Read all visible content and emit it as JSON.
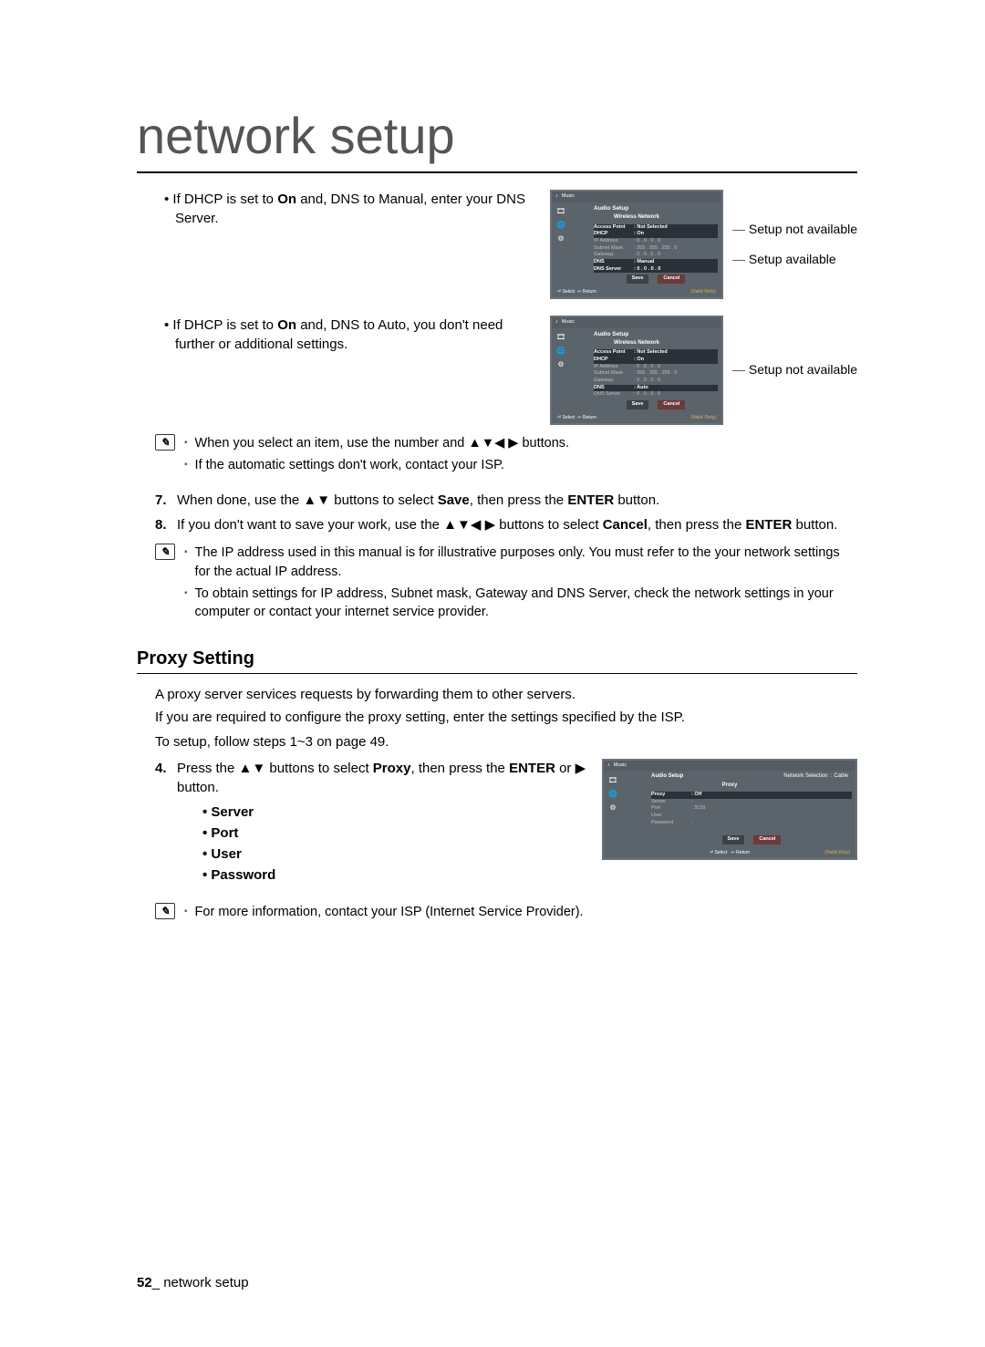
{
  "title": "network setup",
  "block1": {
    "bullet": "If DHCP is set to On and, DNS to Manual, enter your DNS Server.",
    "bold_word": "On",
    "caption1": "Setup not available",
    "caption2": "Setup available"
  },
  "block2": {
    "bullet": "If DHCP is set to On and, DNS to Auto, you don't need further or additional settings.",
    "bold_word": "On",
    "caption1": "Setup not available"
  },
  "note1": {
    "line1": "When you select an item, use the number and ▲▼◀ ▶ buttons.",
    "line2": "If the automatic settings don't work, contact your ISP."
  },
  "steps": {
    "s7": {
      "num": "7.",
      "text_a": "When done, use the ▲▼ buttons to select ",
      "bold1": "Save",
      "text_b": ", then press the ",
      "bold2": "ENTER",
      "text_c": " button."
    },
    "s8": {
      "num": "8.",
      "text_a": "If you don't want to save your work, use the ▲▼◀ ▶ buttons to select ",
      "bold1": "Cancel",
      "text_b": ", then press the ",
      "bold2": "ENTER",
      "text_c": " button."
    }
  },
  "note2": {
    "line1": "The IP address used in this manual is for illustrative purposes only. You must refer to the your network settings for the actual IP address.",
    "line2": "To obtain settings for IP address, Subnet mask, Gateway and DNS Server, check the network settings in your computer or contact your internet service provider."
  },
  "proxy": {
    "heading": "Proxy Setting",
    "p1": "A proxy server services requests by forwarding them to other servers.",
    "p2": "If you are required to configure the proxy setting, enter the settings specified by the ISP.",
    "p3": "To setup, follow steps 1~3 on page 49.",
    "step4": {
      "num": "4.",
      "text_a": "Press the ▲▼ buttons to select ",
      "bold1": "Proxy",
      "text_b": ", then press the ",
      "bold2": "ENTER",
      "text_c": " or ▶ button."
    },
    "items": {
      "a": "Server",
      "b": "Port",
      "c": "User",
      "d": "Password"
    }
  },
  "note3": {
    "line1": "For more information, contact your ISP (Internet Service Provider)."
  },
  "mini1": {
    "header": "Audio Setup",
    "sub": "Wireless Network",
    "rows": [
      {
        "k": "Access Point",
        "v": ": Not Selected"
      },
      {
        "k": "DHCP",
        "v": ": On"
      },
      {
        "k": "IP Address",
        "v": ":    0 .   0 .   0 .   0"
      },
      {
        "k": "Subnet Mask",
        "v": ": 255 . 255 . 255 .   0"
      },
      {
        "k": "Gateway",
        "v": ":    0 .   0 .   0 .   0"
      },
      {
        "k": "DNS",
        "v": ": Manual"
      },
      {
        "k": "DNS Server",
        "v": ":    0 .   0 .   0 .   0"
      }
    ],
    "save": "Save",
    "cancel": "Cancel",
    "sel": "Select",
    "ret": "Return",
    "corner": "(Valid Only)"
  },
  "mini2": {
    "header": "Audio Setup",
    "sub": "Wireless Network",
    "rows": [
      {
        "k": "Access Point",
        "v": ": Not Selected"
      },
      {
        "k": "DHCP",
        "v": ": On"
      },
      {
        "k": "IP Address",
        "v": ":    0 .   0 .   0 .   0"
      },
      {
        "k": "Subnet Mask",
        "v": ": 255 . 255 . 255 .   0"
      },
      {
        "k": "Gateway",
        "v": ":    0 .   0 .   0 .   0"
      },
      {
        "k": "DNS",
        "v": ": Auto"
      },
      {
        "k": "DNS Server",
        "v": ":    0 .   0 .   0 .   0"
      }
    ],
    "save": "Save",
    "cancel": "Cancel",
    "sel": "Select",
    "ret": "Return",
    "corner": "(Valid Only)"
  },
  "mini3": {
    "header": "Audio Setup",
    "crumb_a": "Network Selection",
    "crumb_b": ": Cable",
    "sub": "Proxy",
    "rows": [
      {
        "k": "Proxy",
        "v": ": Off"
      },
      {
        "k": "Server",
        "v": ":"
      },
      {
        "k": "Port",
        "v": ": 3128"
      },
      {
        "k": "User",
        "v": ":"
      },
      {
        "k": "Password",
        "v": ":"
      }
    ],
    "save": "Save",
    "cancel": "Cancel",
    "sel": "Select",
    "ret": "Return",
    "corner": "(Valid Only)"
  },
  "footer": {
    "page": "52",
    "sep": "_",
    "label": " network setup"
  }
}
